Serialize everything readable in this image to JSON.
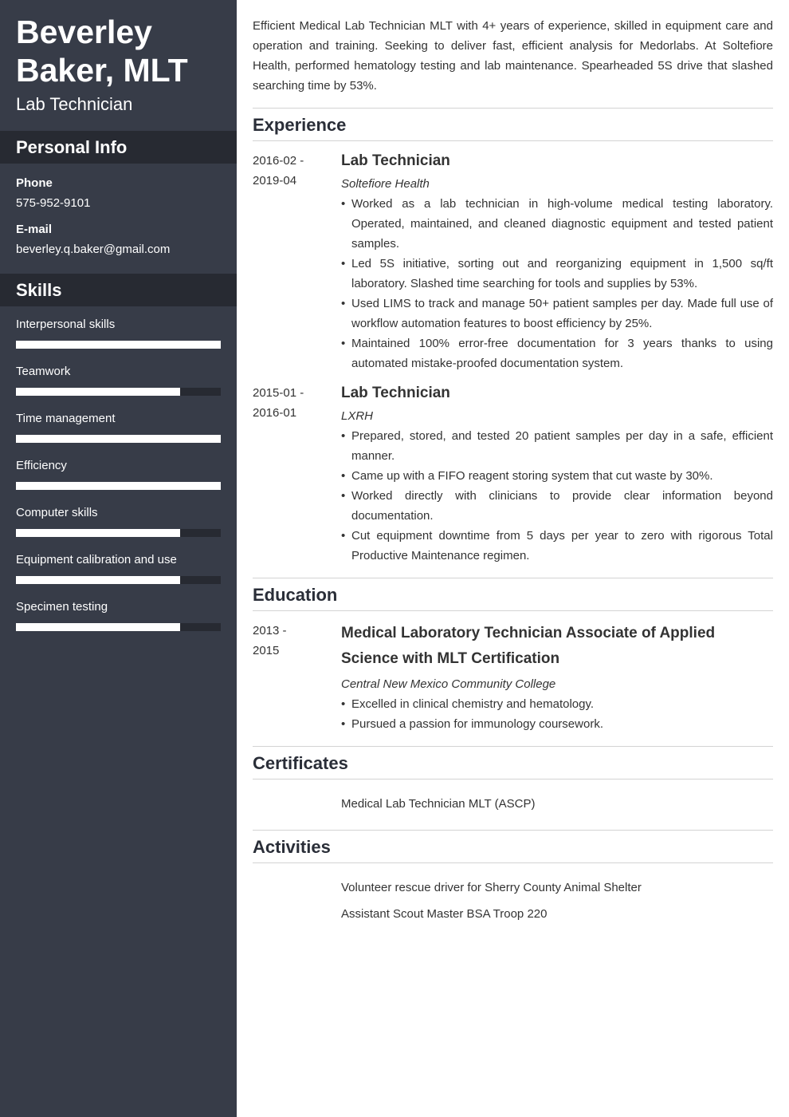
{
  "header": {
    "name_line1": "Beverley",
    "name_line2": "Baker, MLT",
    "job_title": "Lab Technician"
  },
  "personal_info": {
    "heading": "Personal Info",
    "phone_label": "Phone",
    "phone": "575-952-9101",
    "email_label": "E-mail",
    "email": "beverley.q.baker@gmail.com"
  },
  "skills": {
    "heading": "Skills",
    "items": [
      {
        "name": "Interpersonal skills",
        "level": 1.0
      },
      {
        "name": "Teamwork",
        "level": 0.8
      },
      {
        "name": "Time management",
        "level": 1.0
      },
      {
        "name": "Efficiency",
        "level": 1.0
      },
      {
        "name": "Computer skills",
        "level": 0.8
      },
      {
        "name": "Equipment calibration and use",
        "level": 0.8
      },
      {
        "name": "Specimen testing",
        "level": 0.8
      }
    ]
  },
  "summary": "Efficient Medical Lab Technician MLT with 4+ years of experience, skilled in equipment care and operation and training. Seeking to deliver fast, efficient analysis for Medorlabs. At Soltefiore Health, performed hematology testing and lab maintenance. Spearheaded 5S drive that slashed searching time by 53%.",
  "experience": {
    "heading": "Experience",
    "entries": [
      {
        "date_start": "2016-02 -",
        "date_end": "2019-04",
        "title": "Lab Technician",
        "org": "Soltefiore Health",
        "bullets": [
          "Worked as a lab technician in high-volume medical testing laboratory. Operated, maintained, and cleaned diagnostic equipment and tested patient samples.",
          "Led 5S initiative, sorting out and reorganizing equipment in 1,500 sq/ft laboratory. Slashed time searching for tools and supplies by 53%.",
          "Used LIMS to track and manage 50+ patient samples per day. Made full use of workflow automation features to boost efficiency by 25%.",
          "Maintained 100% error-free documentation for 3 years thanks to using automated mistake-proofed documentation system."
        ]
      },
      {
        "date_start": "2015-01 -",
        "date_end": "2016-01",
        "title": "Lab Technician",
        "org": "LXRH",
        "bullets": [
          "Prepared, stored, and tested 20 patient samples per day in a safe, efficient manner.",
          "Came up with a FIFO reagent storing system that cut waste by 30%.",
          "Worked directly with clinicians to provide clear information beyond documentation.",
          "Cut equipment downtime from 5 days per year to zero with rigorous Total Productive Maintenance regimen."
        ]
      }
    ]
  },
  "education": {
    "heading": "Education",
    "entries": [
      {
        "date_start": "2013 -",
        "date_end": "2015",
        "title": "Medical Laboratory Technician Associate of Applied Science with MLT Certification",
        "org": "Central New Mexico Community College",
        "bullets": [
          "Excelled in clinical chemistry and hematology.",
          "Pursued a passion for immunology coursework."
        ]
      }
    ]
  },
  "certificates": {
    "heading": "Certificates",
    "items": [
      "Medical Lab Technician MLT (ASCP)"
    ]
  },
  "activities": {
    "heading": "Activities",
    "items": [
      "Volunteer rescue driver for Sherry County Animal Shelter",
      "Assistant Scout Master BSA Troop 220"
    ]
  }
}
